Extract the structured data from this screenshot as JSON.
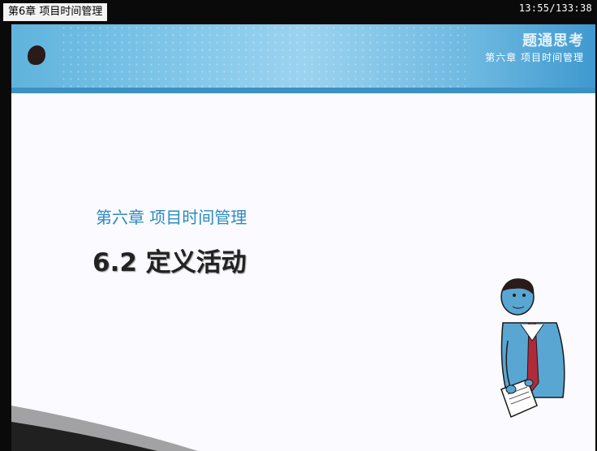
{
  "window": {
    "title": "第6章 项目时间管理",
    "timecode": "13:55/133:38"
  },
  "slide": {
    "banner": {
      "brand": "题通思考",
      "subtitle": "第六章 项目时间管理"
    },
    "chapter": "第六章  项目时间管理",
    "section": "6.2  定义活动",
    "illustration": "businessman-holding-document",
    "colors": {
      "banner": "#6bb7e0",
      "chapter_text": "#2b8bbf",
      "section_text": "#222222",
      "background": "#fafaff"
    }
  }
}
